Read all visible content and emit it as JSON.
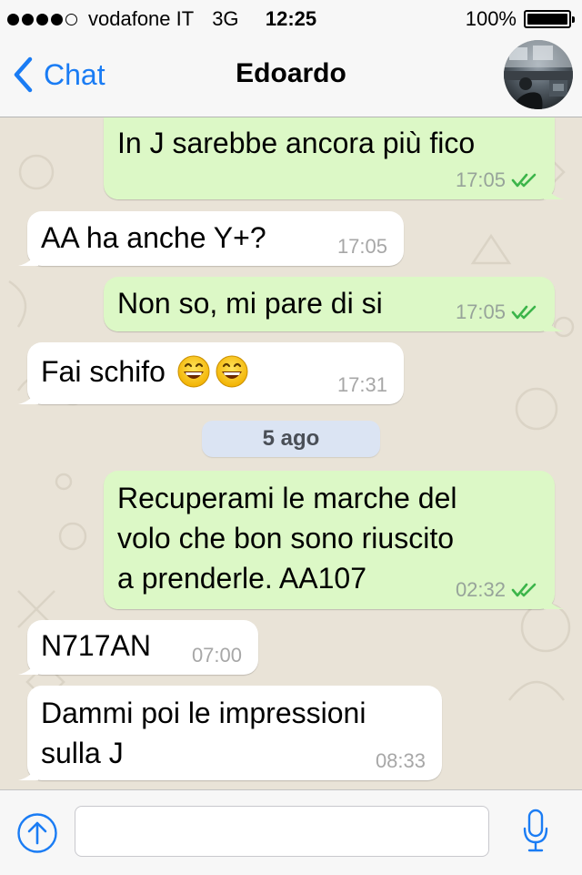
{
  "status_bar": {
    "carrier": "vodafone IT",
    "network": "3G",
    "time": "12:25",
    "battery": "100%",
    "battery_level": 1.0,
    "signal_bars": 4,
    "signal_total": 5
  },
  "nav": {
    "back_label": "Chat",
    "title": "Edoardo"
  },
  "messages": [
    {
      "dir": "out",
      "lines": [
        "In J sarebbe ancora più fico"
      ],
      "time": "17:05",
      "read": true
    },
    {
      "dir": "in",
      "lines": [
        "AA ha anche Y+?"
      ],
      "time": "17:05"
    },
    {
      "dir": "out",
      "lines": [
        "Non so, mi pare di si"
      ],
      "time": "17:05",
      "read": true
    },
    {
      "dir": "in",
      "lines": [
        "Fai schifo"
      ],
      "time": "17:31",
      "emoji": [
        "grinning-face-emoji",
        "grinning-face-emoji"
      ]
    },
    {
      "dir": "out",
      "lines": [
        "Recuperami le marche del",
        "volo che bon sono riuscito",
        "a prenderle. AA107"
      ],
      "time": "02:32",
      "read": true
    },
    {
      "dir": "in",
      "lines": [
        "N717AN"
      ],
      "time": "07:00"
    },
    {
      "dir": "in",
      "lines": [
        "Dammi poi le impressioni",
        "sulla J"
      ],
      "time": "08:33"
    }
  ],
  "date_separator": "5 ago",
  "input": {
    "value": "",
    "placeholder": ""
  },
  "icons": {
    "back": "chevron-left-icon",
    "attach": "upload-arrow-icon",
    "mic": "microphone-icon",
    "read": "double-check-icon"
  },
  "colors": {
    "accent": "#1a7cf4",
    "outgoing_bubble": "#dcf8c6",
    "incoming_bubble": "#ffffff",
    "read_check": "#3cb54a",
    "date_pill": "#dbe4f3"
  }
}
